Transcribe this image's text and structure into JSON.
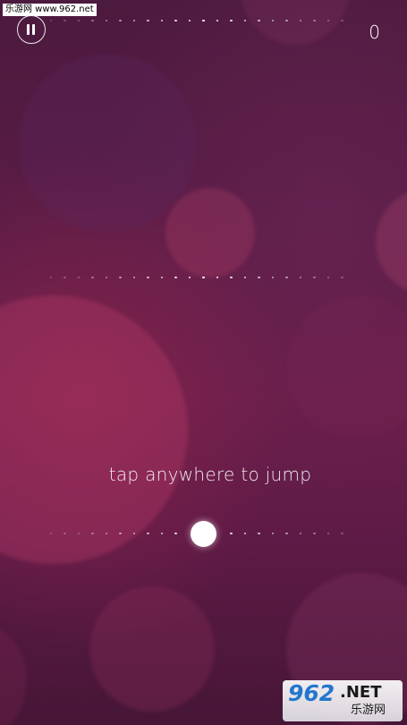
{
  "watermark": {
    "text": "乐游网 www.962.net"
  },
  "hud": {
    "pause_icon": "pause-icon",
    "score": "0"
  },
  "hint": {
    "text": "tap anywhere to jump"
  },
  "logo": {
    "number": "962",
    "net": ".NET",
    "chinese": "乐游网"
  },
  "colors": {
    "background_top": "#4c1a3e",
    "background_mid": "#6a1d48",
    "background_bottom": "#461636",
    "dots": "#ffffff",
    "ball": "#ffffff",
    "logo_number": "#2277cc"
  }
}
